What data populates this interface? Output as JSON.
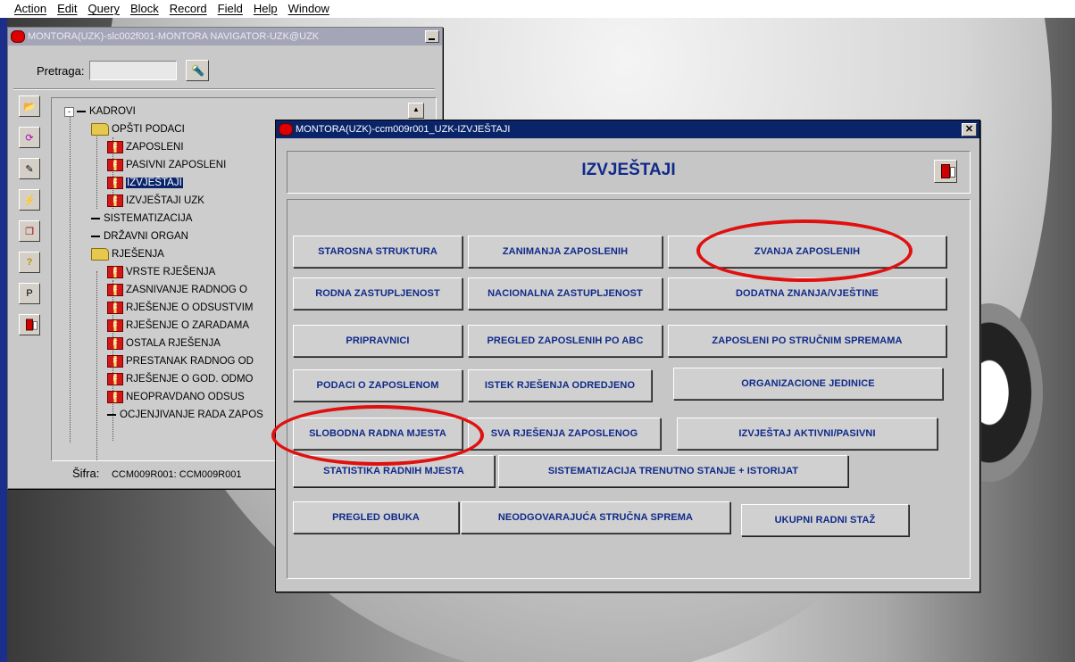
{
  "menu": [
    "Action",
    "Edit",
    "Query",
    "Block",
    "Record",
    "Field",
    "Help",
    "Window"
  ],
  "navigator": {
    "title": "MONTORA(UZK)-slc002f001-MONTORA NAVIGATOR-UZK@UZK",
    "search_label": "Pretraga:",
    "search_value": "",
    "toolbar_p_label": "P",
    "tree": [
      "KADROVI",
      "OPŠTI PODACI",
      "ZAPOSLENI",
      "PASIVNI ZAPOSLENI",
      "IZVJEŠTAJI",
      "IZVJEŠTAJI UZK",
      "SISTEMATIZACIJA",
      "DRŽAVNI ORGAN",
      "RJEŠENJA",
      "VRSTE RJEŠENJA",
      "ZASNIVANJE RADNOG O",
      "RJEŠENJE O ODSUSTVIM",
      "RJEŠENJE O ZARADAMA",
      "OSTALA RJEŠENJA",
      "PRESTANAK RADNOG OD",
      "RJEŠENJE O GOD. ODMO",
      "NEOPRAVDANO ODSUS",
      "OCJENJIVANJE RADA ZAPOS"
    ],
    "sifra_label": "Šifra:",
    "sifra_value": "CCM009R001: CCM009R001"
  },
  "dialog": {
    "title": "MONTORA(UZK)-ccm009r001_UZK-IZVJEŠTAJI",
    "heading": "IZVJEŠTAJI",
    "buttons": [
      "STAROSNA STRUKTURA",
      "ZANIMANJA ZAPOSLENIH",
      "ZVANJA ZAPOSLENIH",
      "RODNA ZASTUPLJENOST",
      "NACIONALNA ZASTUPLJENOST",
      "DODATNA ZNANJA/VJEŠTINE",
      "PRIPRAVNICI",
      "PREGLED ZAPOSLENIH PO ABC",
      "ZAPOSLENI PO STRUČNIM SPREMAMA",
      "PODACI O ZAPOSLENOM",
      "ISTEK RJEŠENJA ODREDJENO",
      "ORGANIZACIONE JEDINICE",
      "SLOBODNA RADNA MJESTA",
      "SVA RJEŠENJA ZAPOSLENOG",
      "IZVJEŠTAJ AKTIVNI/PASIVNI",
      "STATISTIKA RADNIH MJESTA",
      "SISTEMATIZACIJA TRENUTNO STANJE + ISTORIJAT",
      "PREGLED OBUKA",
      "NEODGOVARAJUĆA STRUČNA SPREMA",
      "UKUPNI RADNI STAŽ"
    ]
  },
  "colors": {
    "button_text": "#102a8a",
    "highlight_oval": "#e01010",
    "active_title": "#0a246a"
  }
}
